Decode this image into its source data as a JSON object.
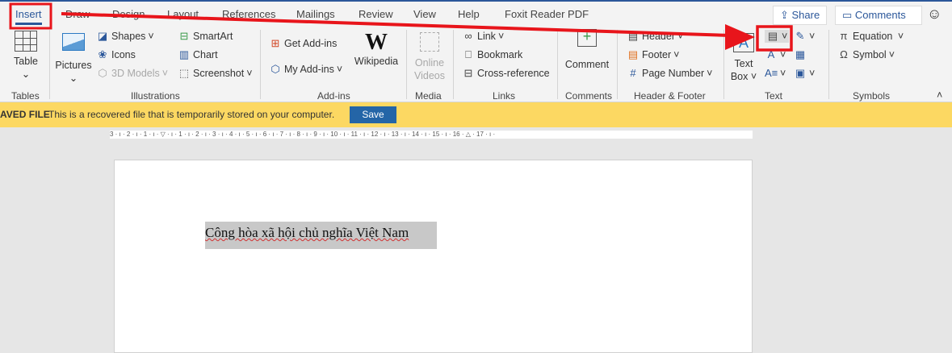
{
  "tabs": [
    "Insert",
    "Draw",
    "Design",
    "Layout",
    "References",
    "Mailings",
    "Review",
    "View",
    "Help",
    "Foxit Reader PDF"
  ],
  "share_label": "Share",
  "comments_label": "Comments",
  "groups": {
    "tables": {
      "label": "Tables",
      "table": "Table"
    },
    "illustrations": {
      "label": "Illustrations",
      "pictures": "Pictures",
      "shapes": "Shapes",
      "icons": "Icons",
      "models": "3D Models",
      "smartart": "SmartArt",
      "chart": "Chart",
      "screenshot": "Screenshot"
    },
    "addins": {
      "label": "Add-ins",
      "get": "Get Add-ins",
      "my": "My Add-ins",
      "wikipedia": "Wikipedia"
    },
    "media": {
      "label": "Media",
      "online_videos_1": "Online",
      "online_videos_2": "Videos"
    },
    "links": {
      "label": "Links",
      "link": "Link",
      "bookmark": "Bookmark",
      "crossref": "Cross-reference"
    },
    "comments": {
      "label": "Comments",
      "comment": "Comment"
    },
    "headerfooter": {
      "label": "Header & Footer",
      "header": "Header",
      "footer": "Footer",
      "page_number": "Page Number"
    },
    "text": {
      "label": "Text",
      "textbox_1": "Text",
      "textbox_2": "Box"
    },
    "symbols": {
      "label": "Symbols",
      "equation": "Equation",
      "symbol": "Symbol"
    }
  },
  "banner": {
    "title": "AVED FILE",
    "message": "This is a recovered file that is temporarily stored on your computer.",
    "save": "Save"
  },
  "ruler": "3 · ı · 2 · ı · 1 · ı · ▽ · ı · 1 · ı · 2 · ı · 3 · ı · 4 · ı · 5 · ı · 6 · ı · 7 · ı · 8 · ı · 9 · ı · 10 · ı · 11 · ı · 12 · ı · 13 · ı · 14 · ı · 15 · ı · 16 · △ · 17 · ı ·",
  "document": {
    "text": "Công hòa xã hội chủ nghĩa Việt Nam"
  },
  "colors": {
    "accent": "#2b579a",
    "annotation": "#e8151b",
    "banner": "#fcd862"
  }
}
